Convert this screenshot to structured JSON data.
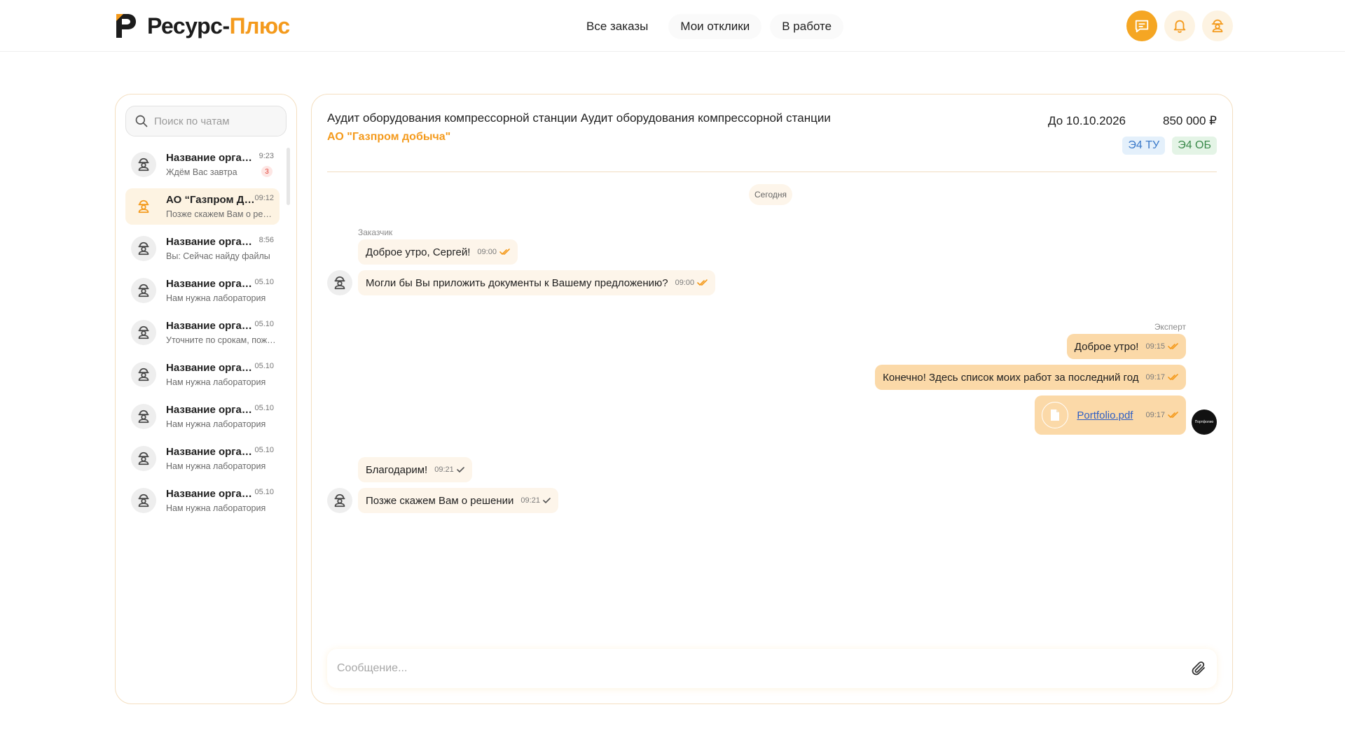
{
  "brand": {
    "name_part1": "Ресурс-",
    "name_part2": "Плюс",
    "accent_color": "#f49a1c"
  },
  "nav": {
    "items": [
      {
        "label": "Все заказы"
      },
      {
        "label": "Мои отклики"
      },
      {
        "label": "В работе"
      }
    ]
  },
  "header_icons": [
    "chat-icon",
    "bell-icon",
    "worker-profile-icon"
  ],
  "sidebar": {
    "search_placeholder": "Поиск по чатам",
    "chats": [
      {
        "name": "Название организации",
        "time": "9:23",
        "preview": "Ждём Вас завтра",
        "badge": "3"
      },
      {
        "name": "АО “Газпром Добыча”",
        "time": "09:12",
        "preview": "Позже скажем Вам о решении"
      },
      {
        "name": "Название организации",
        "time": "8:56",
        "preview": "Вы: Сейчас найду файлы"
      },
      {
        "name": "Название организации",
        "time": "05.10",
        "preview": "Нам нужна лаборатория"
      },
      {
        "name": "Название организации",
        "time": "05.10",
        "preview": "Уточните по срокам, пожалуйста"
      },
      {
        "name": "Название организации",
        "time": "05.10",
        "preview": "Нам нужна лаборатория"
      },
      {
        "name": "Название организации",
        "time": "05.10",
        "preview": "Нам нужна лаборатория"
      },
      {
        "name": "Название организации",
        "time": "05.10",
        "preview": "Нам нужна лаборатория"
      },
      {
        "name": "Название организации",
        "time": "05.10",
        "preview": "Нам нужна лаборатория"
      }
    ]
  },
  "order": {
    "title": "Аудит оборудования компрессорной станции Аудит оборудования компрессорной станции",
    "company": "АО \"Газпром добыча\"",
    "deadline": "До 10.10.2026",
    "price": "850 000 ₽",
    "tags": [
      "Э4 ТУ",
      "Э4 ОБ"
    ]
  },
  "chat": {
    "date_label": "Сегодня",
    "customer_label": "Заказчик",
    "expert_label": "Эксперт",
    "expert_avatar_text": "Портфолио",
    "messages": [
      {
        "text": "Доброе утро, Сергей!",
        "time": "09:00"
      },
      {
        "text": "Могли бы Вы приложить документы к Вашему предложению?",
        "time": "09:00"
      },
      {
        "text": "Доброе утро!",
        "time": "09:15"
      },
      {
        "text": "Конечно! Здесь список моих работ за последний год",
        "time": "09:17"
      },
      {
        "file": "Portfolio.pdf",
        "time": "09:17"
      },
      {
        "text": "Благодарим!",
        "time": "09:21"
      },
      {
        "text": "Позже скажем Вам о решении",
        "time": "09:21"
      }
    ],
    "composer_placeholder": "Сообщение..."
  }
}
